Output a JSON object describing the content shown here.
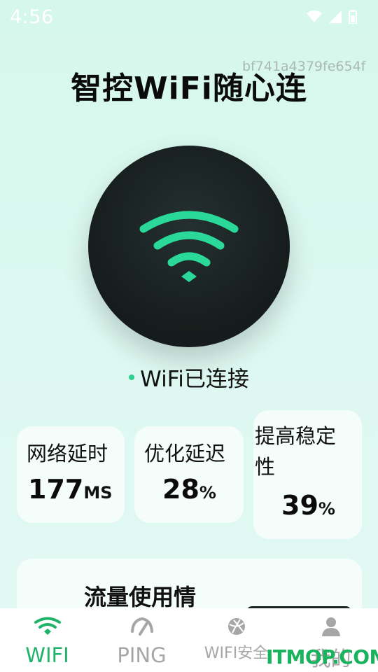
{
  "status": {
    "time": "4:56"
  },
  "device_id": "bf741a4379fe654f",
  "title": "智控WiFi随心连",
  "connection": {
    "status_text": "WiFi已连接"
  },
  "stats": [
    {
      "label": "网络延时",
      "value": "177",
      "unit": "MS"
    },
    {
      "label": "优化延迟",
      "value": "28",
      "unit": "%"
    },
    {
      "label_line1": "提高稳定",
      "label_line2": "性",
      "value": "39",
      "unit": "%"
    }
  ],
  "usage": {
    "title": "流量使用情"
  },
  "tabs": [
    {
      "label": "WIFI",
      "icon": "wifi-icon",
      "active": true
    },
    {
      "label": "PING",
      "icon": "ping-gauge-icon",
      "active": false
    },
    {
      "label": "WIFI安全",
      "icon": "globe-shield-icon",
      "active": false
    },
    {
      "label": "我的",
      "icon": "person-icon",
      "active": false
    }
  ],
  "watermark": "ITMOP.COM",
  "colors": {
    "accent": "#2ad08f",
    "tab_active": "#1fb36a",
    "tab_inactive": "#a6a6a6",
    "circle": "#151c1b"
  }
}
